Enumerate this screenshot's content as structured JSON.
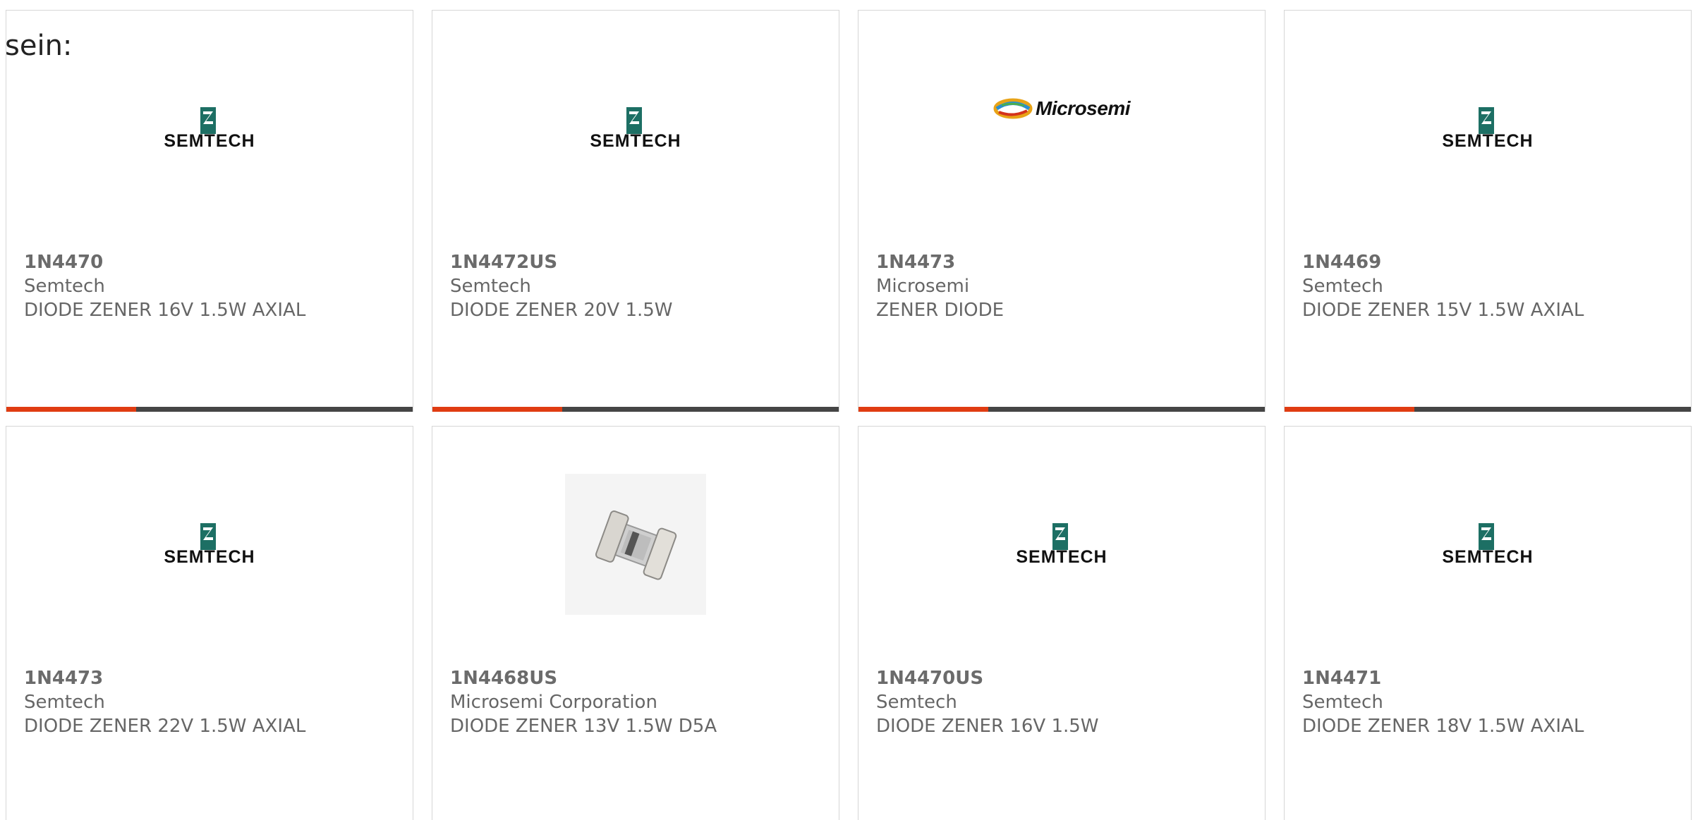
{
  "intro_text": "sein:",
  "accent_color": "#e03c12",
  "bar_color": "#454545",
  "cards": [
    {
      "part_number": "1N4470",
      "manufacturer": "Semtech",
      "description": "DIODE ZENER 16V 1.5W AXIAL",
      "image": "semtech-logo",
      "logo_text": "SEMTECH",
      "progress": 0.32
    },
    {
      "part_number": "1N4472US",
      "manufacturer": "Semtech",
      "description": "DIODE ZENER 20V 1.5W",
      "image": "semtech-logo",
      "logo_text": "SEMTECH",
      "progress": 0.32
    },
    {
      "part_number": "1N4473",
      "manufacturer": "Microsemi",
      "description": "ZENER DIODE",
      "image": "microsemi-logo",
      "logo_text": "Microsemi",
      "progress": 0.32
    },
    {
      "part_number": "1N4469",
      "manufacturer": "Semtech",
      "description": "DIODE ZENER 15V 1.5W AXIAL",
      "image": "semtech-logo",
      "logo_text": "SEMTECH",
      "progress": 0.32
    },
    {
      "part_number": "1N4473",
      "manufacturer": "Semtech",
      "description": "DIODE ZENER 22V 1.5W AXIAL",
      "image": "semtech-logo",
      "logo_text": "SEMTECH"
    },
    {
      "part_number": "1N4468US",
      "manufacturer": "Microsemi Corporation",
      "description": "DIODE ZENER 13V 1.5W D5A",
      "image": "diode-product-photo"
    },
    {
      "part_number": "1N4470US",
      "manufacturer": "Semtech",
      "description": "DIODE ZENER 16V 1.5W",
      "image": "semtech-logo",
      "logo_text": "SEMTECH"
    },
    {
      "part_number": "1N4471",
      "manufacturer": "Semtech",
      "description": "DIODE ZENER 18V 1.5W AXIAL",
      "image": "semtech-logo",
      "logo_text": "SEMTECH"
    }
  ]
}
